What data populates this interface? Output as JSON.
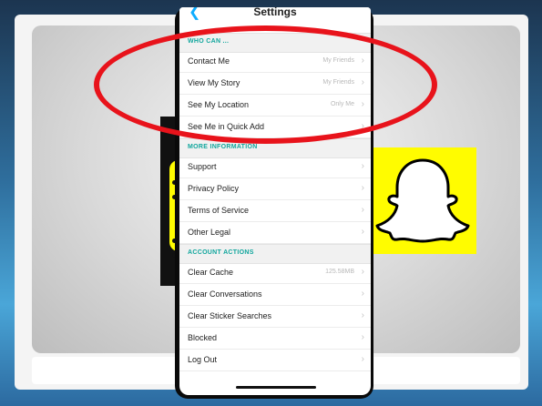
{
  "screen": {
    "title": "Settings",
    "back_icon": "chevron-left-icon"
  },
  "sections": [
    {
      "header": "WHO CAN ...",
      "rows": [
        {
          "label": "Contact Me",
          "value": "My Friends"
        },
        {
          "label": "View My Story",
          "value": "My Friends"
        },
        {
          "label": "See My Location",
          "value": "Only Me"
        },
        {
          "label": "See Me in Quick Add",
          "value": ""
        }
      ]
    },
    {
      "header": "MORE INFORMATION",
      "rows": [
        {
          "label": "Support",
          "value": ""
        },
        {
          "label": "Privacy Policy",
          "value": ""
        },
        {
          "label": "Terms of Service",
          "value": ""
        },
        {
          "label": "Other Legal",
          "value": ""
        }
      ]
    },
    {
      "header": "ACCOUNT ACTIONS",
      "rows": [
        {
          "label": "Clear Cache",
          "value": "125.58MB"
        },
        {
          "label": "Clear Conversations",
          "value": ""
        },
        {
          "label": "Clear Sticker Searches",
          "value": ""
        },
        {
          "label": "Blocked",
          "value": ""
        },
        {
          "label": "Log Out",
          "value": ""
        }
      ]
    }
  ],
  "colors": {
    "accent": "#0eadff",
    "section_header": "#11a69d",
    "highlight": "#e8131b",
    "snapchat_yellow": "#fffc00"
  },
  "icons": {
    "row_chevron": "chevron-right-icon",
    "logo": "snapchat-ghost-icon"
  }
}
